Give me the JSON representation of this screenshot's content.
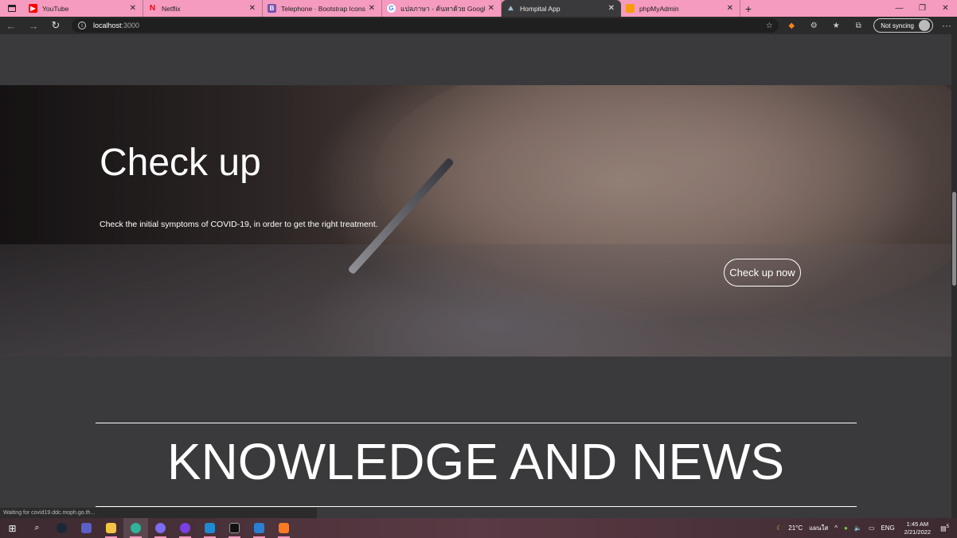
{
  "browser": {
    "tabs": [
      {
        "title": "YouTube",
        "favicon": "youtube-icon",
        "color": "#ff0000",
        "active": false
      },
      {
        "title": "Netflix",
        "favicon": "netflix-icon",
        "color": "#e50914",
        "active": false
      },
      {
        "title": "Telephone · Bootstrap Icons",
        "favicon": "bootstrap-icon",
        "color": "#7952b3",
        "active": false
      },
      {
        "title": "แปลภาษา - ค้นหาด้วย Google",
        "favicon": "google-icon",
        "color": "#4285f4",
        "active": false
      },
      {
        "title": "Hompital App",
        "favicon": "app-icon",
        "color": "#9ec3d8",
        "active": true
      },
      {
        "title": "phpMyAdmin",
        "favicon": "phpmyadmin-icon",
        "color": "#f89c0e",
        "active": false
      }
    ],
    "url_host": "localhost",
    "url_port": ":3000",
    "sync_label": "Not syncing",
    "status_text": "Waiting for covid19.ddc.moph.go.th..."
  },
  "hero": {
    "title": "Check up",
    "description": "Check the initial symptoms of COVID-19, in order to get the right treatment.",
    "cta_label": "Check up now"
  },
  "news": {
    "title": "KNOWLEDGE AND NEWS"
  },
  "taskbar": {
    "weather": "21°C",
    "weather_text": "แผนใส",
    "lang": "ENG",
    "time": "1:45 AM",
    "date": "2/21/2022",
    "notification_count": "5"
  }
}
